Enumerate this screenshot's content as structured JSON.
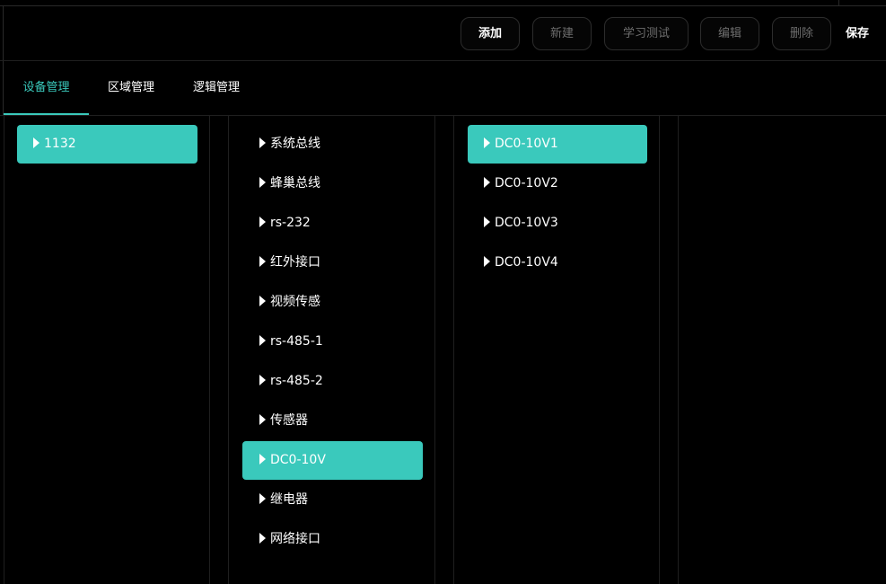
{
  "toolbar": {
    "buttons": [
      {
        "label": "添加",
        "enabled": true
      },
      {
        "label": "新建",
        "enabled": false
      },
      {
        "label": "学习测试",
        "enabled": false
      },
      {
        "label": "编辑",
        "enabled": false
      },
      {
        "label": "删除",
        "enabled": false
      }
    ],
    "save_label": "保存"
  },
  "tabs": [
    {
      "label": "设备管理",
      "active": true
    },
    {
      "label": "区域管理",
      "active": false
    },
    {
      "label": "逻辑管理",
      "active": false
    }
  ],
  "columns": {
    "devices": {
      "items": [
        {
          "label": "1132",
          "selected": true
        }
      ]
    },
    "interfaces": {
      "items": [
        {
          "label": "系统总线",
          "selected": false
        },
        {
          "label": "蜂巢总线",
          "selected": false
        },
        {
          "label": "rs-232",
          "selected": false
        },
        {
          "label": "红外接口",
          "selected": false
        },
        {
          "label": "视频传感",
          "selected": false
        },
        {
          "label": "rs-485-1",
          "selected": false
        },
        {
          "label": "rs-485-2",
          "selected": false
        },
        {
          "label": "传感器",
          "selected": false
        },
        {
          "label": "DC0-10V",
          "selected": true
        },
        {
          "label": "继电器",
          "selected": false
        },
        {
          "label": "网络接口",
          "selected": false
        }
      ]
    },
    "channels": {
      "items": [
        {
          "label": "DC0-10V1",
          "selected": true
        },
        {
          "label": "DC0-10V2",
          "selected": false
        },
        {
          "label": "DC0-10V3",
          "selected": false
        },
        {
          "label": "DC0-10V4",
          "selected": false
        }
      ]
    },
    "details": {
      "items": []
    }
  },
  "colors": {
    "accent": "#3ac9bc",
    "background": "#000000",
    "border": "#1f1f1f",
    "disabled_text": "#6e6e6e"
  }
}
